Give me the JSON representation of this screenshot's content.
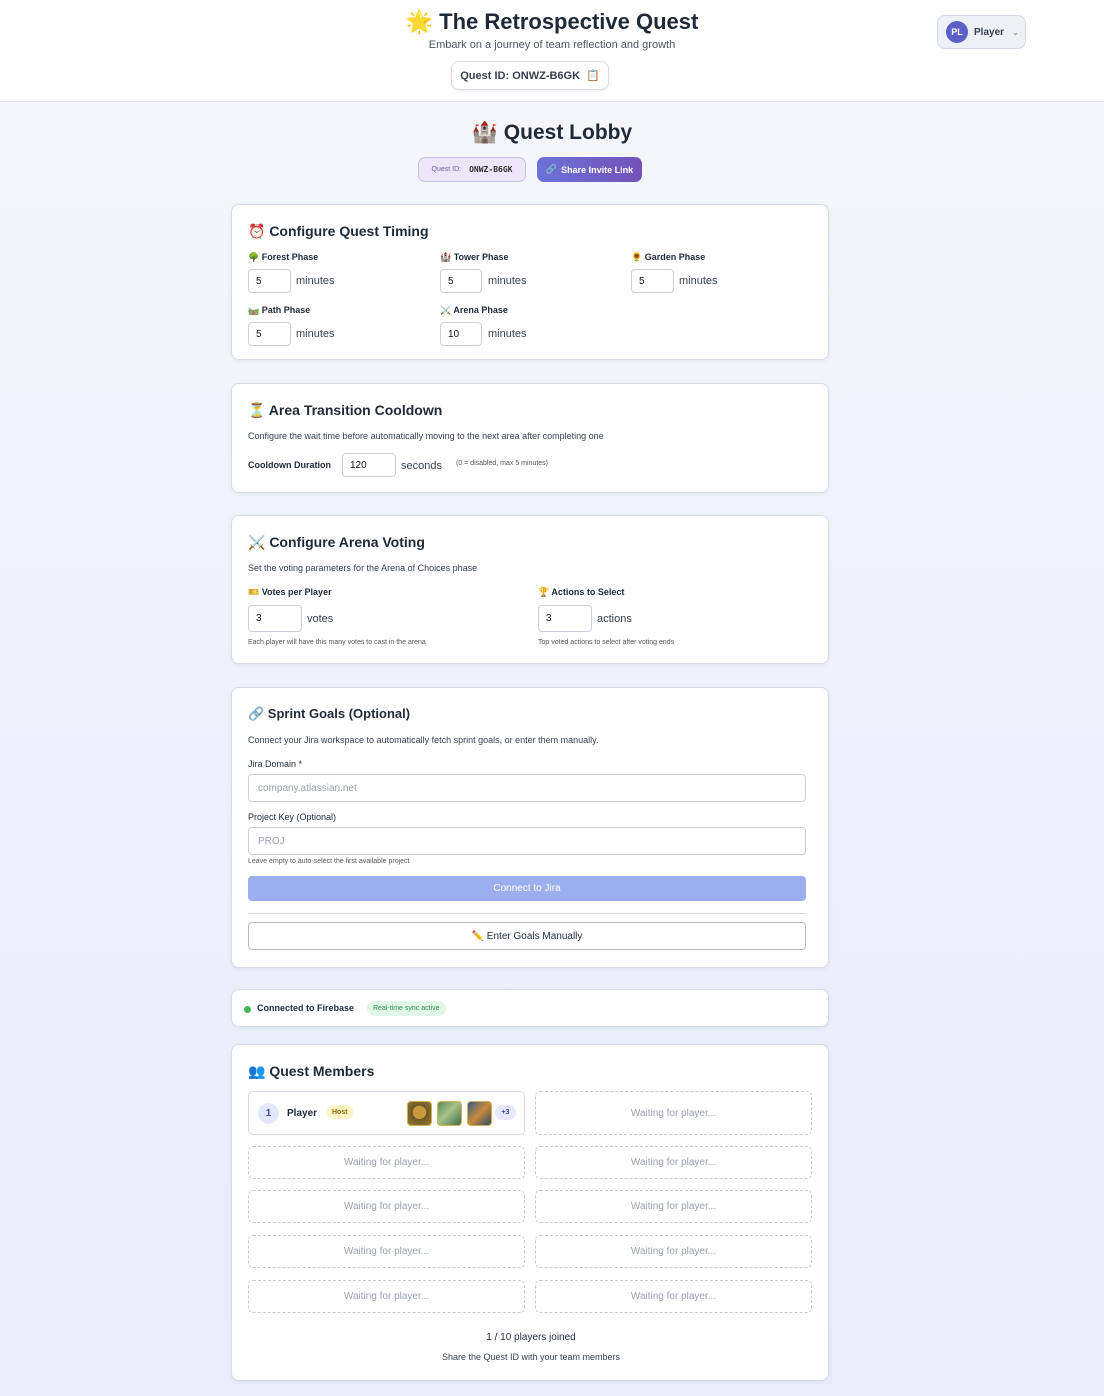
{
  "header": {
    "title": "🌟 The Retrospective Quest",
    "subtitle": "Embark on a journey of team reflection and growth",
    "quest_id_label": "Quest ID: ONWZ-B6GK",
    "copy_icon": "📋",
    "user": {
      "initials": "PL",
      "name": "Player"
    }
  },
  "lobby": {
    "title": "🏰 Quest Lobby",
    "id_label": "Quest ID:",
    "id_value": "ONWZ-B6GK",
    "share_icon": "🔗",
    "share_label": "Share Invite Link"
  },
  "timing": {
    "title": "⏰ Configure Quest Timing",
    "unit": "minutes",
    "phases": [
      {
        "label": "🌳 Forest Phase",
        "value": "5"
      },
      {
        "label": "🏰 Tower Phase",
        "value": "5"
      },
      {
        "label": "🌻 Garden Phase",
        "value": "5"
      },
      {
        "label": "🛤️ Path Phase",
        "value": "5"
      },
      {
        "label": "⚔️ Arena Phase",
        "value": "10"
      }
    ]
  },
  "cooldown": {
    "title": "⏳ Area Transition Cooldown",
    "description": "Configure the wait time before automatically moving to the next area after completing one",
    "label": "Cooldown Duration",
    "value": "120",
    "unit": "seconds",
    "hint": "(0 = disabled, max 5 minutes)"
  },
  "voting": {
    "title": "⚔️ Configure Arena Voting",
    "description": "Set the voting parameters for the Arena of Choices phase",
    "votes": {
      "label": "🎫 Votes per Player",
      "value": "3",
      "unit": "votes",
      "hint": "Each player will have this many votes to cast in the arena"
    },
    "actions": {
      "label": "🏆 Actions to Select",
      "value": "3",
      "unit": "actions",
      "hint": "Top voted actions to select after voting ends"
    }
  },
  "sprint": {
    "title": "🔗 Sprint Goals (Optional)",
    "description": "Connect your Jira workspace to automatically fetch sprint goals, or enter them manually.",
    "domain_label": "Jira Domain *",
    "domain_placeholder": "company.atlassian.net",
    "project_label": "Project Key (Optional)",
    "project_placeholder": "PROJ",
    "project_hint": "Leave empty to auto-select the first available project",
    "connect_label": "Connect to Jira",
    "manual_label": "✏️ Enter Goals Manually"
  },
  "firebase": {
    "status": "Connected to Firebase",
    "badge": "Real-time sync active",
    "status_color": "#3cba54"
  },
  "members": {
    "title": "👥 Quest Members",
    "player": {
      "number": "1",
      "name": "Player",
      "badge": "Host",
      "more": "+3"
    },
    "waiting_text": "Waiting for player...",
    "count_text": "1 / 10 players joined",
    "share_hint": "Share the Quest ID with your team members"
  }
}
